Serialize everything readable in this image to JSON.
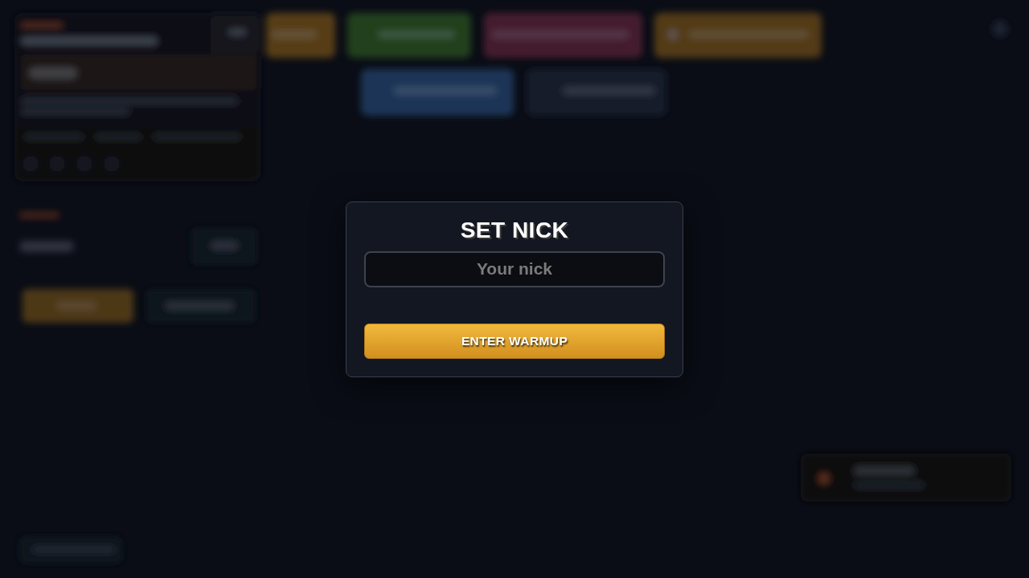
{
  "dialog": {
    "title": "SET NICK",
    "nick_field": {
      "placeholder": "Your nick"
    },
    "submit_button": "ENTER WARMUP"
  }
}
